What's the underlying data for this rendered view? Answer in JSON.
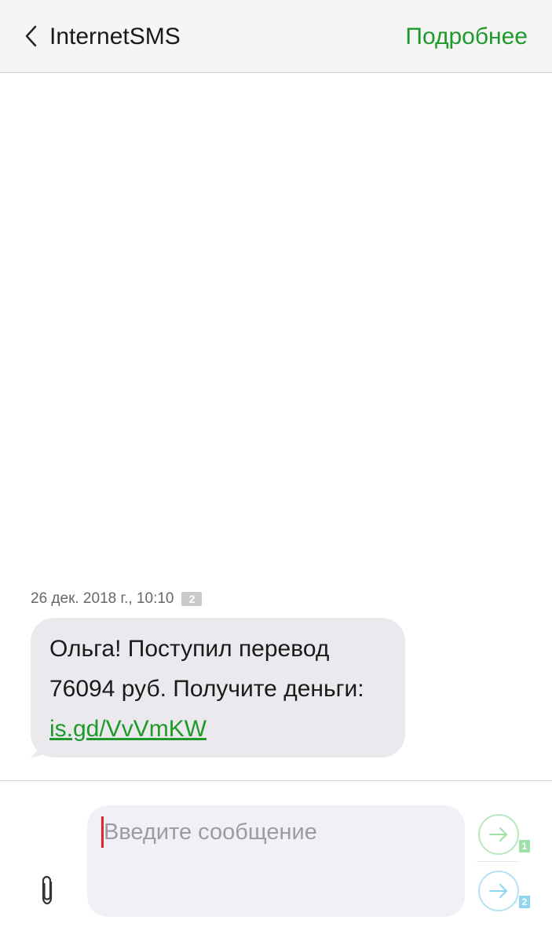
{
  "header": {
    "title": "InternetSMS",
    "details_label": "Подробнее"
  },
  "message": {
    "timestamp": "26 дек. 2018 г., 10:10",
    "sim_badge": "2",
    "text": "Ольга! Поступил перевод 76094 руб. Получите деньги: ",
    "link_text": "is.gd/VvVmKW"
  },
  "composer": {
    "placeholder": "Введите сообщение",
    "send_sim1_label": "1",
    "send_sim2_label": "2"
  },
  "colors": {
    "accent": "#1e9a2b",
    "bubble": "#ebe9ee",
    "input": "#f3eff6",
    "sim1": "#9ee0a6",
    "sim2": "#8fd6ee",
    "cursor": "#e0262b"
  }
}
